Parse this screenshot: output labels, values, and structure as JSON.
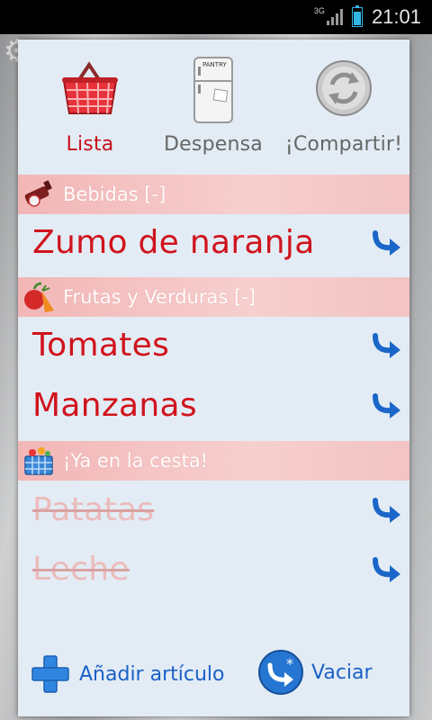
{
  "status_bar": {
    "network": "3G",
    "time": "21:01"
  },
  "nav": {
    "lista": "Lista",
    "despensa": "Despensa",
    "compartir": "¡Compartir!",
    "fridge_label": "PANTRY"
  },
  "categories": [
    {
      "label": "Bebidas [-]",
      "icon": "drinks-icon"
    },
    {
      "label": "Frutas y Verduras [-]",
      "icon": "fruit-icon"
    },
    {
      "label": "¡Ya en la cesta!",
      "icon": "basket-icon"
    }
  ],
  "items": {
    "bebidas": [
      {
        "name": "Zumo de naranja"
      }
    ],
    "frutas": [
      {
        "name": "Tomates"
      },
      {
        "name": "Manzanas"
      }
    ],
    "en_cesta": [
      {
        "name": "Patatas"
      },
      {
        "name": "Leche"
      }
    ]
  },
  "footer": {
    "add_label": "Añadir artículo",
    "clear_label": "Vaciar"
  },
  "colors": {
    "item_text": "#d0131c",
    "done_text": "#ecbbbb",
    "category_bg": "#f2b6b6",
    "accent_blue": "#1a60c8",
    "paper": "#e3ecf5"
  }
}
